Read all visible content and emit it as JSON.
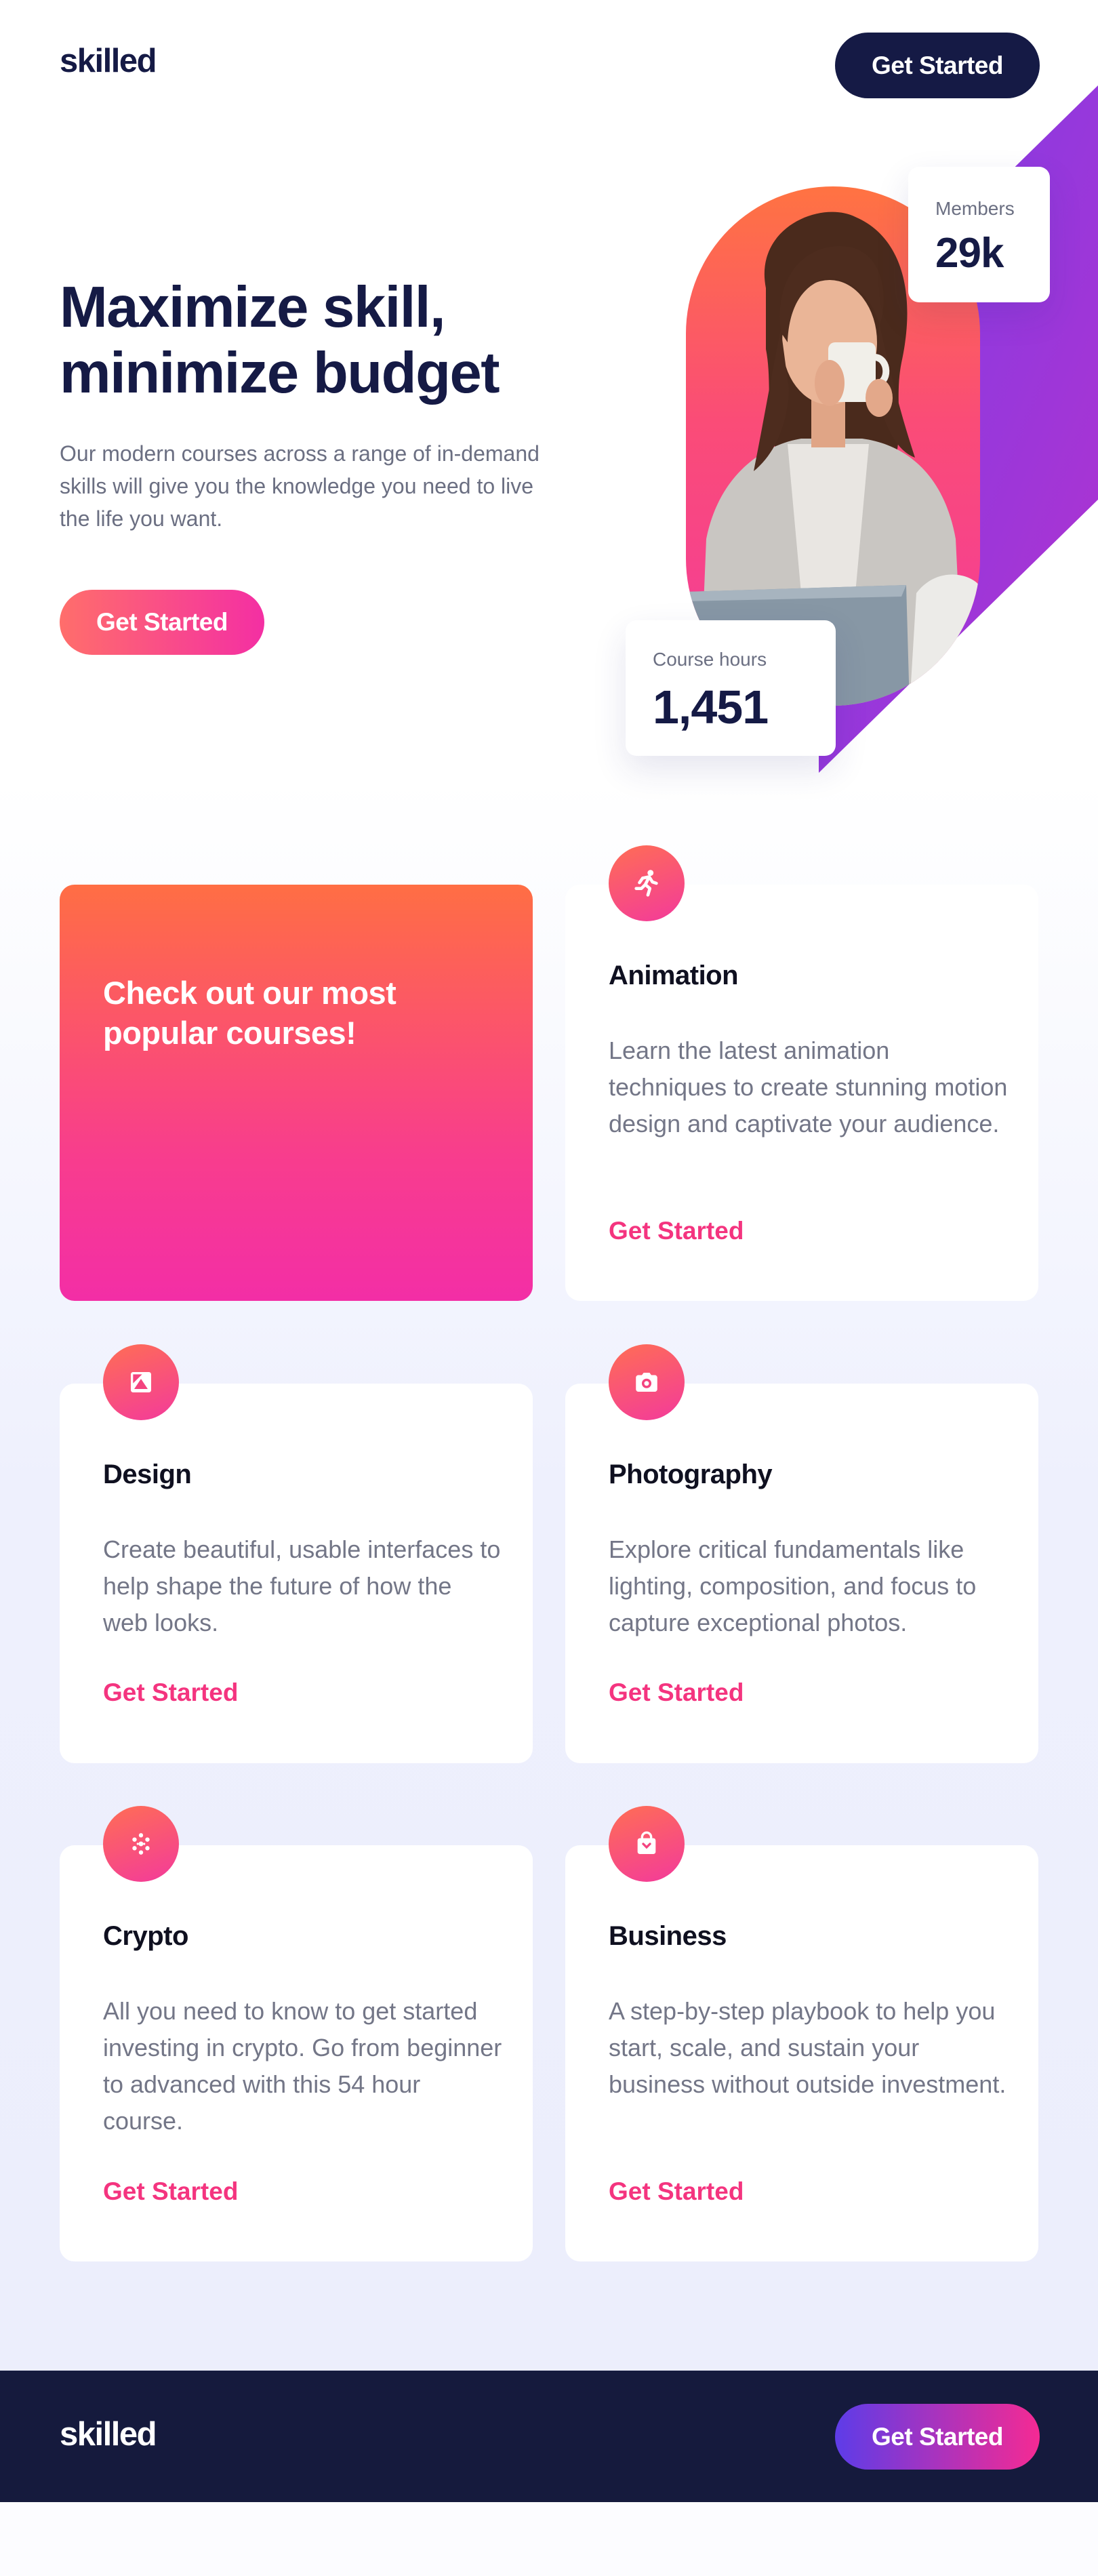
{
  "header": {
    "logo": "skilled",
    "cta_label": "Get Started"
  },
  "hero": {
    "title_line1": "Maximize skill,",
    "title_line2": "minimize budget",
    "description": "Our modern courses across a range of in-demand skills will give you the knowledge you need to live the life you want.",
    "cta_label": "Get Started",
    "members": {
      "label": "Members",
      "value": "29k"
    },
    "course_hours": {
      "label": "Course hours",
      "value": "1,451"
    }
  },
  "courses": {
    "feature_title": "Check out our most popular courses!",
    "items": [
      {
        "title": "Animation",
        "description": "Learn the latest animation techniques to create stunning motion design and captivate your audience.",
        "link": "Get Started",
        "icon": "running-figure-icon"
      },
      {
        "title": "Design",
        "description": "Create beautiful, usable interfaces to help shape the future of how the web looks.",
        "link": "Get Started",
        "icon": "image-frame-icon"
      },
      {
        "title": "Photography",
        "description": "Explore critical fundamentals like lighting, composition, and focus to capture exceptional photos.",
        "link": "Get Started",
        "icon": "camera-icon"
      },
      {
        "title": "Crypto",
        "description": "All you need to know to get started investing in crypto. Go from beginner to advanced with this 54 hour course.",
        "link": "Get Started",
        "icon": "crypto-dots-icon"
      },
      {
        "title": "Business",
        "description": "A step-by-step playbook to help you start, scale, and sustain your business without outside investment.",
        "link": "Get Started",
        "icon": "shopping-bag-icon"
      }
    ]
  },
  "footer": {
    "logo": "skilled",
    "cta_label": "Get Started"
  },
  "colors": {
    "navy": "#151a45",
    "pink": "#f4347f",
    "orange": "#ff6e44",
    "purple": "#6b3ae6"
  }
}
